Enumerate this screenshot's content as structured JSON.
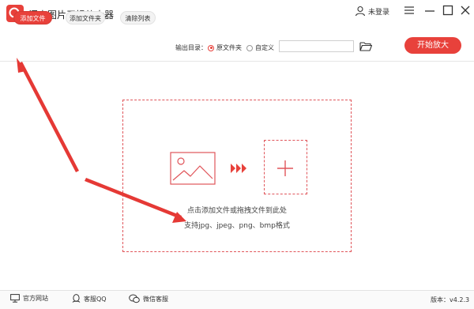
{
  "app": {
    "title": "闪电图片无损放大器"
  },
  "user": {
    "label": "未登录"
  },
  "toolbar": {
    "add_file": "添加文件",
    "add_folder": "添加文件夹",
    "clear_list": "清除列表",
    "output_label": "输出目录：",
    "option_source": "原文件夹",
    "option_custom": "自定义",
    "path_value": "",
    "start": "开始放大"
  },
  "dropzone": {
    "hint_line1": "点击添加文件或拖拽文件到此处",
    "hint_line2": "支持jpg、jpeg、png、bmp格式"
  },
  "footer": {
    "website": "官方网站",
    "qq": "客服QQ",
    "wechat": "微信客服",
    "version": "版本：v4.2.3"
  },
  "colors": {
    "accent": "#e8413b",
    "annotation": "#e53935"
  },
  "icons": [
    "logo-icon",
    "user-icon",
    "menu-icon",
    "minimize-icon",
    "maximize-icon",
    "close-icon",
    "folder-icon",
    "image-icon",
    "arrows-icon",
    "plus-icon",
    "monitor-icon",
    "qq-icon",
    "wechat-icon"
  ]
}
